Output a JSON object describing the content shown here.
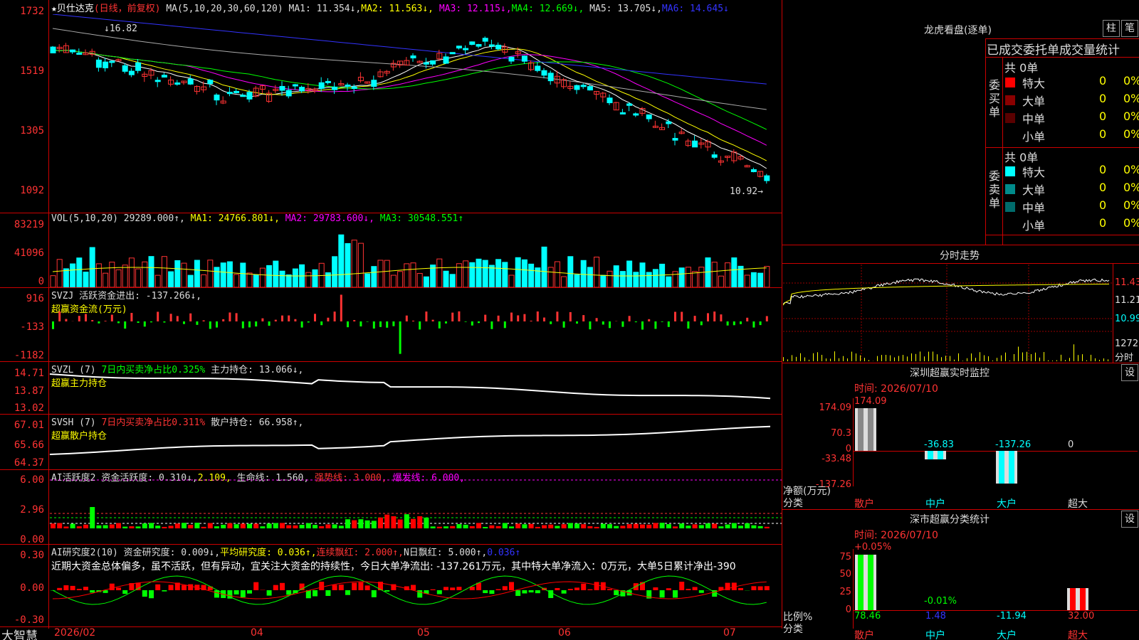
{
  "stock": {
    "name": "★贝仕达克",
    "mode": "(日线，前复权)",
    "ma_line": "MA(5,10,20,30,60,120)",
    "ma1": "MA1: 11.354↓,",
    "ma2": "MA2: 11.563↓,",
    "ma3": "MA3: 12.115↓,",
    "ma4": "MA4: 12.669↓,",
    "ma5": "MA5: 13.705↓,",
    "ma6": "MA6: 14.645↓",
    "high_label": "↓16.82",
    "low_label": "10.92→"
  },
  "price_axis": [
    "1732",
    "1519",
    "1305",
    "1092"
  ],
  "vol": {
    "head": "VOL(5,10,20)",
    "v": "29289.000↑,",
    "ma1": "MA1: 24766.801↓,",
    "ma2": "MA2: 29783.600↓,",
    "ma3": "MA3: 30548.551↑",
    "axis": [
      "83219",
      "41096",
      "0"
    ]
  },
  "svzj": {
    "head": "SVZJ",
    "t1": "活跃资金进出: -137.266↓,",
    "t2": "超赢资金流(万元)",
    "axis": [
      "916",
      "-133",
      "-1182"
    ]
  },
  "svzl": {
    "head": "SVZL (7)",
    "t1": "7日内买卖净占比0.325%",
    "t2": "主力持仓: 13.066↓,",
    "t3": "超赢主力持仓",
    "axis": [
      "14.71",
      "13.87",
      "13.02"
    ]
  },
  "svsh": {
    "head": "SVSH (7)",
    "t1": "7日内买卖净占比0.311%",
    "t2": "散户持仓: 66.958↑,",
    "t3": "超赢散户持仓",
    "axis": [
      "67.01",
      "65.66",
      "64.37"
    ]
  },
  "ai1": {
    "t0": "AI活跃度2",
    "t1": "资金活跃度: 0.310↓,",
    "t2": "2.109,",
    "t3": "生命线: 1.560,",
    "t4": "强势线: 3.000,",
    "t5": "爆发线: 6.000,",
    "axis": [
      "6.00",
      "2.96",
      "0.00"
    ]
  },
  "ai2": {
    "t0": "AI研究度2(10)",
    "t1": "资金研究度: 0.009↓,",
    "t2": "平均研究度: 0.036↑,",
    "t3": "连续飘红: 2.000↑,",
    "t4": "N日飘红: 5.000↑,",
    "t5": "0.036↑",
    "desc": "近期大资金总体偏多，虽不活跃，但有异动，宜关注大资金的持续性，今日大单净流出: -137.261万元，其中特大单净流入：0万元，大单5日累计净出-390",
    "axis": [
      "0.30",
      "0.00",
      "-0.30"
    ]
  },
  "xaxis": {
    "brand": "大智慧",
    "labels": [
      "2026/02",
      "04",
      "05",
      "06",
      "07"
    ]
  },
  "right": {
    "lhb_title": "龙虎看盘(逐单)",
    "btn1": "柱",
    "btn2": "笔",
    "table_title": "已成交委托单成交量统计",
    "buy_label": "委买单",
    "buy_total": "共 0单",
    "sell_label": "委卖单",
    "sell_total": "共 0单",
    "buy_rows": [
      {
        "name": "特大",
        "count": "0",
        "pct": "0%",
        "color": "#ff0000"
      },
      {
        "name": "大单",
        "count": "0",
        "pct": "0%",
        "color": "#8b0000"
      },
      {
        "name": "中单",
        "count": "0",
        "pct": "0%",
        "color": "#5a0000"
      },
      {
        "name": "小单",
        "count": "0",
        "pct": "0%",
        "color": "#000000"
      }
    ],
    "sell_rows": [
      {
        "name": "特大",
        "count": "0",
        "pct": "0%",
        "color": "#00ffff"
      },
      {
        "name": "大单",
        "count": "0",
        "pct": "0%",
        "color": "#008b8b"
      },
      {
        "name": "中单",
        "count": "0",
        "pct": "0%",
        "color": "#006b6b"
      },
      {
        "name": "小单",
        "count": "0",
        "pct": "0%",
        "color": "#000000"
      }
    ],
    "fs_title": "分时走势",
    "fs_axis": [
      "11.43",
      "11.21",
      "10.99"
    ],
    "fs_vol": "1272",
    "fs_vol2": "分时",
    "sz_title": "深圳超赢实时监控",
    "set": "设",
    "sz_time": "时间: 2026/07/10",
    "sz_axis": [
      "174.09",
      "70.3",
      "0",
      "-33.48",
      "-137.26"
    ],
    "sz_vals": [
      "174.09",
      "-36.83",
      "-137.26",
      "0"
    ],
    "sz_ylabel": "净额(万元)",
    "sz_xlabel": "分类",
    "cats": [
      "散户",
      "中户",
      "大户",
      "超大"
    ],
    "fl_title": "深市超赢分类统计",
    "fl_time": "时间: 2026/07/10",
    "fl_axis": [
      "75",
      "50",
      "25",
      "0"
    ],
    "fl_tops": [
      "+0.05%",
      "-0.01%"
    ],
    "fl_vals": [
      "78.46",
      "1.48",
      "-11.94",
      "32.00"
    ],
    "fl_ylabel": "比例%",
    "fl_xlabel": "分类"
  }
}
